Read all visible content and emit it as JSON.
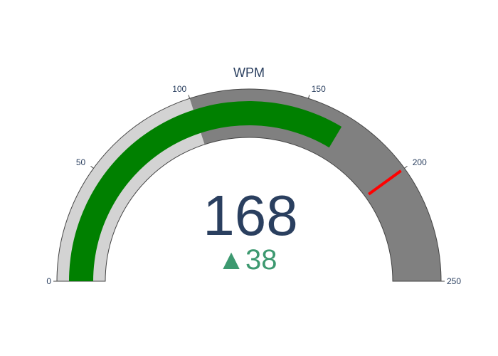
{
  "chart_data": {
    "type": "gauge",
    "title": "WPM",
    "value": 168,
    "delta": {
      "value": 38,
      "display": "38",
      "symbol": "▲",
      "direction": "increasing"
    },
    "axis": {
      "range": [
        0,
        250
      ],
      "ticks": [
        0,
        50,
        100,
        150,
        200,
        250
      ],
      "tick_labels": [
        "0",
        "50",
        "100",
        "150",
        "200",
        "250"
      ]
    },
    "bar": {
      "value": 168,
      "color": "#008000"
    },
    "steps": [
      {
        "range": [
          0,
          100
        ],
        "color": "#d3d3d3"
      },
      {
        "range": [
          100,
          250
        ],
        "color": "#808080"
      }
    ],
    "threshold": {
      "value": 200,
      "color": "#ff0000"
    },
    "colors": {
      "text": "#2a3f5f",
      "delta_increasing": "#3d9970",
      "border": "#444444"
    }
  }
}
